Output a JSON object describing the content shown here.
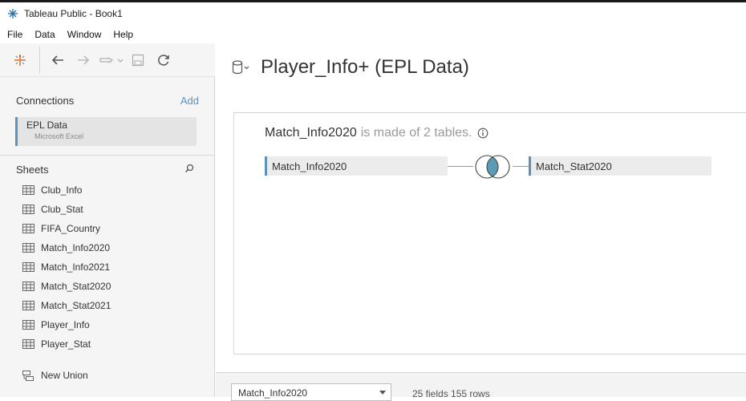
{
  "window": {
    "title": "Tableau Public - Book1"
  },
  "menu": [
    "File",
    "Data",
    "Window",
    "Help"
  ],
  "toolbar": {
    "icons": [
      "tableau-logo-icon",
      "back-arrow-icon",
      "forward-arrow-icon",
      "redo-icon",
      "save-icon",
      "refresh-icon"
    ]
  },
  "connections": {
    "header": "Connections",
    "add_label": "Add",
    "items": [
      {
        "name": "EPL Data",
        "type": "Microsoft Excel"
      }
    ]
  },
  "sheets": {
    "header": "Sheets",
    "items": [
      "Club_Info",
      "Club_Stat",
      "FIFA_Country",
      "Match_Info2020",
      "Match_Info2021",
      "Match_Stat2020",
      "Match_Stat2021",
      "Player_Info",
      "Player_Stat"
    ],
    "new_union": "New Union"
  },
  "datasource": {
    "title": "Player_Info+ (EPL Data)"
  },
  "canvas": {
    "logical_table": "Match_Info2020",
    "made_of_text": "is made of 2 tables.",
    "left_table": "Match_Info2020",
    "right_table": "Match_Stat2020",
    "join_type": "inner"
  },
  "bottom": {
    "selected_table": "Match_Info2020",
    "fields_info": "25 fields 155 rows"
  },
  "colors": {
    "accent": "#5b93c0",
    "join_fill": "#5b9bb5"
  }
}
